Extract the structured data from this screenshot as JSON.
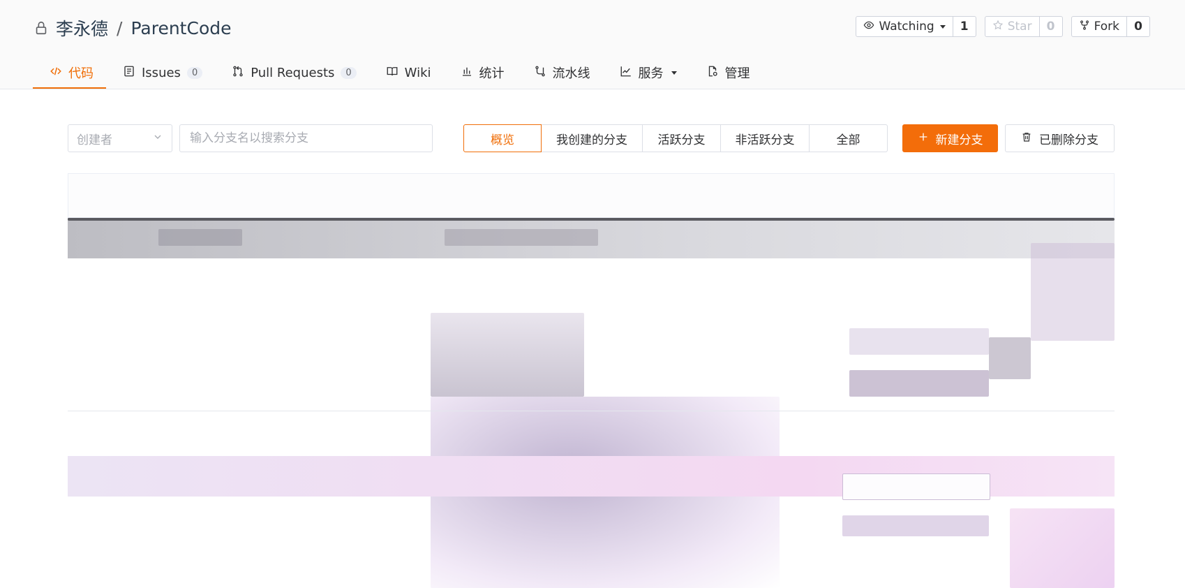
{
  "repo": {
    "owner": "李永德",
    "separator": "/",
    "name": "ParentCode"
  },
  "actions": {
    "watch": {
      "label": "Watching",
      "count": "1"
    },
    "star": {
      "label": "Star",
      "count": "0"
    },
    "fork": {
      "label": "Fork",
      "count": "0"
    }
  },
  "tabs": [
    {
      "label": "代码",
      "icon": "code-icon",
      "active": true
    },
    {
      "label": "Issues",
      "icon": "issues-icon",
      "badge": "0"
    },
    {
      "label": "Pull Requests",
      "icon": "pull-request-icon",
      "badge": "0"
    },
    {
      "label": "Wiki",
      "icon": "book-icon"
    },
    {
      "label": "统计",
      "icon": "bar-chart-icon"
    },
    {
      "label": "流水线",
      "icon": "pipeline-icon"
    },
    {
      "label": "服务",
      "icon": "line-chart-icon",
      "dropdown": true
    },
    {
      "label": "管理",
      "icon": "settings-doc-icon"
    }
  ],
  "toolbar": {
    "creator_placeholder": "创建者",
    "search_placeholder": "输入分支名以搜索分支",
    "filters": [
      "概览",
      "我创建的分支",
      "活跃分支",
      "非活跃分支",
      "全部"
    ],
    "new_branch": "新建分支",
    "deleted_branches": "已删除分支"
  },
  "colors": {
    "accent": "#f06e08",
    "primary_button": "#f36d0a"
  }
}
